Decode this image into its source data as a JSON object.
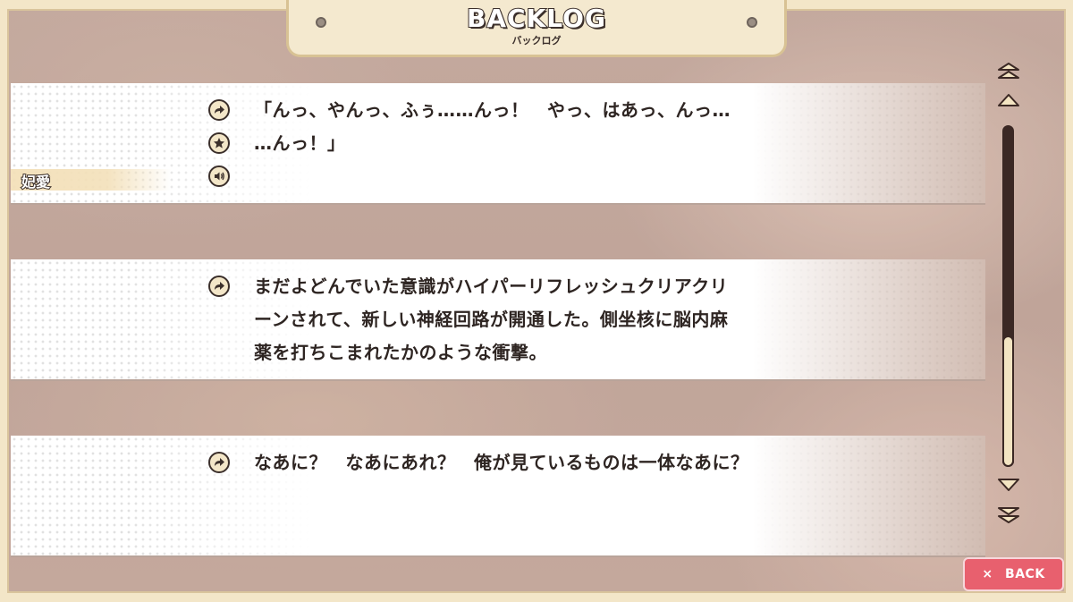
{
  "header": {
    "title": "BACKLOG",
    "subtitle": "バックログ"
  },
  "entries": [
    {
      "speaker": "妃愛",
      "text": "「んっ、やんっ、ふぅ……んっ！　やっ、はあっ、んっ…\n…んっ！」",
      "icons": [
        "jump-icon",
        "favorite-star-icon",
        "voice-replay-icon"
      ]
    },
    {
      "speaker": "",
      "text": "まだよどんでいた意識がハイパーリフレッシュクリアクリ\nーンされて、新しい神経回路が開通した。側坐核に脳内麻\n薬を打ちこまれたかのような衝撃。",
      "icons": [
        "jump-icon"
      ]
    },
    {
      "speaker": "",
      "text": "なあに？　なあにあれ？　俺が見ているものは一体なあに？",
      "icons": [
        "jump-icon"
      ]
    }
  ],
  "scrollbar": {
    "position_fraction": 0.62,
    "visible_fraction": 0.38,
    "buttons": [
      "scroll-top",
      "scroll-up",
      "scroll-down",
      "scroll-bottom"
    ]
  },
  "back_button": {
    "icon": "close-x-icon",
    "icon_glyph": "×",
    "label": "BACK"
  },
  "colors": {
    "frame": "#f3e6c8",
    "frame_border": "#d8c294",
    "text": "#2e2522",
    "back_button": "#e8606e",
    "scroll_track": "#3b2824",
    "scroll_thumb": "#f3e4c2"
  }
}
